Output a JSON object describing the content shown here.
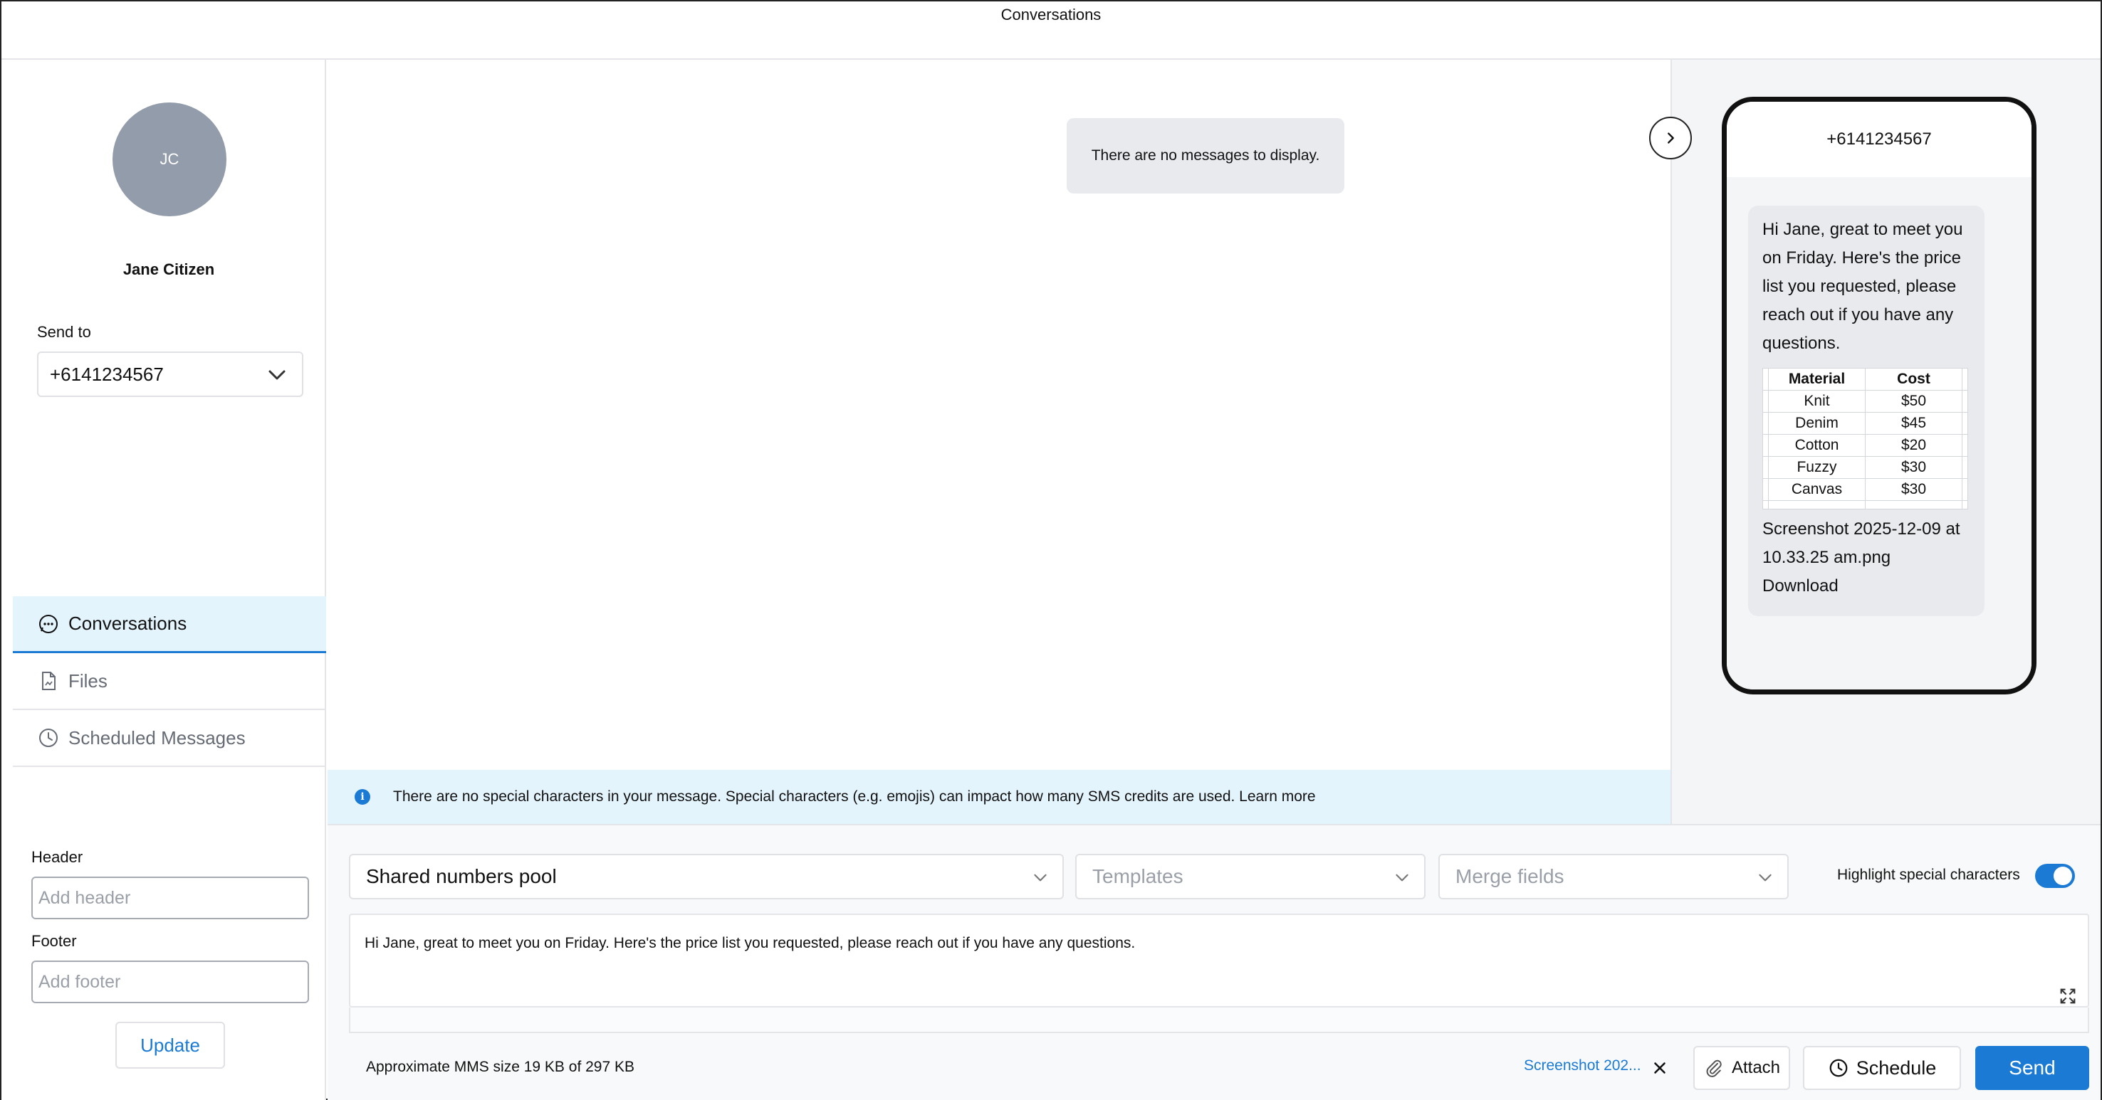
{
  "app": {
    "title": "Conversations"
  },
  "contact": {
    "initials": "JC",
    "name": "Jane Citizen",
    "send_to_label": "Send to",
    "send_to_value": "+6141234567"
  },
  "nav": {
    "items": [
      {
        "label": "Conversations",
        "icon": "chat-bubble-icon",
        "active": true
      },
      {
        "label": "Files",
        "icon": "file-icon",
        "active": false
      },
      {
        "label": "Scheduled Messages",
        "icon": "clock-icon",
        "active": false
      }
    ]
  },
  "mms_fields": {
    "header_label": "Header",
    "header_placeholder": "Add header",
    "footer_label": "Footer",
    "footer_placeholder": "Add footer",
    "update_label": "Update"
  },
  "thread": {
    "empty_message": "There are no messages to display."
  },
  "info_banner": {
    "icon": "info-icon",
    "text": "There are no special characters in your message. Special characters (e.g. emojis) can impact how many SMS credits are used. Learn more"
  },
  "preview": {
    "phone_number": "+6141234567",
    "message": "Hi Jane, great to meet you on Friday. Here's the price list you requested, please reach out if you have any questions.",
    "table": {
      "headers": [
        "Material",
        "Cost"
      ],
      "rows": [
        [
          "Knit",
          "$50"
        ],
        [
          "Denim",
          "$45"
        ],
        [
          "Cotton",
          "$20"
        ],
        [
          "Fuzzy",
          "$30"
        ],
        [
          "Canvas",
          "$30"
        ]
      ]
    },
    "attachment_name": "Screenshot 2025-12-09 at 10.33.25 am.png",
    "download_label": "Download"
  },
  "composer": {
    "sender_select": "Shared numbers pool",
    "templates_placeholder": "Templates",
    "merge_fields_placeholder": "Merge fields",
    "highlight_label": "Highlight special characters",
    "highlight_enabled": true,
    "message_text": "Hi Jane, great to meet you on Friday. Here's the price list you requested, please reach out if you have any questions.",
    "mms_size": "Approximate MMS size 19 KB of 297 KB",
    "attachment_short": "Screenshot 202...",
    "attach_label": "Attach",
    "schedule_label": "Schedule",
    "send_label": "Send"
  },
  "colors": {
    "accent": "#1b7bd4",
    "info_bg": "#e4f4fd",
    "avatar_bg": "#939cab",
    "bubble_bg": "#e8eaee"
  }
}
